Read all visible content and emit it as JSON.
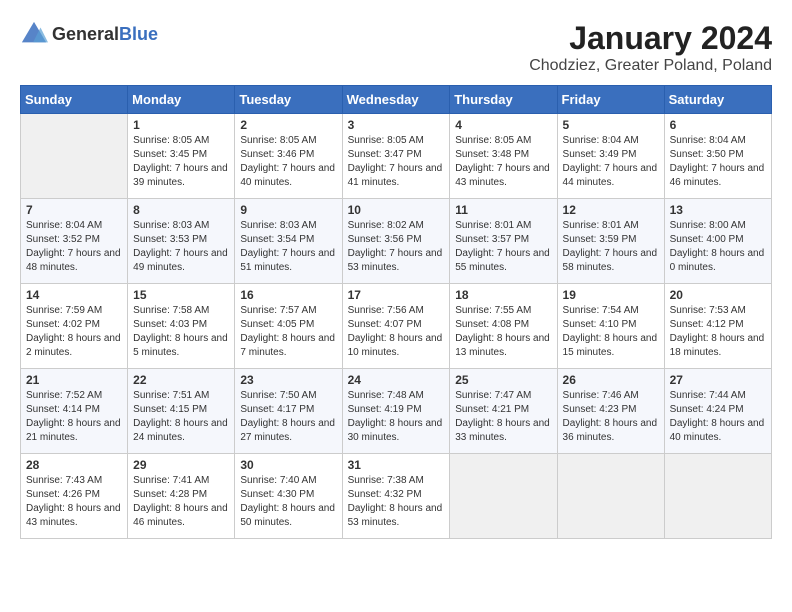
{
  "header": {
    "logo_general": "General",
    "logo_blue": "Blue",
    "title": "January 2024",
    "subtitle": "Chodziez, Greater Poland, Poland"
  },
  "weekdays": [
    "Sunday",
    "Monday",
    "Tuesday",
    "Wednesday",
    "Thursday",
    "Friday",
    "Saturday"
  ],
  "weeks": [
    [
      {
        "day": "",
        "sunrise": "",
        "sunset": "",
        "daylight": ""
      },
      {
        "day": "1",
        "sunrise": "Sunrise: 8:05 AM",
        "sunset": "Sunset: 3:45 PM",
        "daylight": "Daylight: 7 hours and 39 minutes."
      },
      {
        "day": "2",
        "sunrise": "Sunrise: 8:05 AM",
        "sunset": "Sunset: 3:46 PM",
        "daylight": "Daylight: 7 hours and 40 minutes."
      },
      {
        "day": "3",
        "sunrise": "Sunrise: 8:05 AM",
        "sunset": "Sunset: 3:47 PM",
        "daylight": "Daylight: 7 hours and 41 minutes."
      },
      {
        "day": "4",
        "sunrise": "Sunrise: 8:05 AM",
        "sunset": "Sunset: 3:48 PM",
        "daylight": "Daylight: 7 hours and 43 minutes."
      },
      {
        "day": "5",
        "sunrise": "Sunrise: 8:04 AM",
        "sunset": "Sunset: 3:49 PM",
        "daylight": "Daylight: 7 hours and 44 minutes."
      },
      {
        "day": "6",
        "sunrise": "Sunrise: 8:04 AM",
        "sunset": "Sunset: 3:50 PM",
        "daylight": "Daylight: 7 hours and 46 minutes."
      }
    ],
    [
      {
        "day": "7",
        "sunrise": "Sunrise: 8:04 AM",
        "sunset": "Sunset: 3:52 PM",
        "daylight": "Daylight: 7 hours and 48 minutes."
      },
      {
        "day": "8",
        "sunrise": "Sunrise: 8:03 AM",
        "sunset": "Sunset: 3:53 PM",
        "daylight": "Daylight: 7 hours and 49 minutes."
      },
      {
        "day": "9",
        "sunrise": "Sunrise: 8:03 AM",
        "sunset": "Sunset: 3:54 PM",
        "daylight": "Daylight: 7 hours and 51 minutes."
      },
      {
        "day": "10",
        "sunrise": "Sunrise: 8:02 AM",
        "sunset": "Sunset: 3:56 PM",
        "daylight": "Daylight: 7 hours and 53 minutes."
      },
      {
        "day": "11",
        "sunrise": "Sunrise: 8:01 AM",
        "sunset": "Sunset: 3:57 PM",
        "daylight": "Daylight: 7 hours and 55 minutes."
      },
      {
        "day": "12",
        "sunrise": "Sunrise: 8:01 AM",
        "sunset": "Sunset: 3:59 PM",
        "daylight": "Daylight: 7 hours and 58 minutes."
      },
      {
        "day": "13",
        "sunrise": "Sunrise: 8:00 AM",
        "sunset": "Sunset: 4:00 PM",
        "daylight": "Daylight: 8 hours and 0 minutes."
      }
    ],
    [
      {
        "day": "14",
        "sunrise": "Sunrise: 7:59 AM",
        "sunset": "Sunset: 4:02 PM",
        "daylight": "Daylight: 8 hours and 2 minutes."
      },
      {
        "day": "15",
        "sunrise": "Sunrise: 7:58 AM",
        "sunset": "Sunset: 4:03 PM",
        "daylight": "Daylight: 8 hours and 5 minutes."
      },
      {
        "day": "16",
        "sunrise": "Sunrise: 7:57 AM",
        "sunset": "Sunset: 4:05 PM",
        "daylight": "Daylight: 8 hours and 7 minutes."
      },
      {
        "day": "17",
        "sunrise": "Sunrise: 7:56 AM",
        "sunset": "Sunset: 4:07 PM",
        "daylight": "Daylight: 8 hours and 10 minutes."
      },
      {
        "day": "18",
        "sunrise": "Sunrise: 7:55 AM",
        "sunset": "Sunset: 4:08 PM",
        "daylight": "Daylight: 8 hours and 13 minutes."
      },
      {
        "day": "19",
        "sunrise": "Sunrise: 7:54 AM",
        "sunset": "Sunset: 4:10 PM",
        "daylight": "Daylight: 8 hours and 15 minutes."
      },
      {
        "day": "20",
        "sunrise": "Sunrise: 7:53 AM",
        "sunset": "Sunset: 4:12 PM",
        "daylight": "Daylight: 8 hours and 18 minutes."
      }
    ],
    [
      {
        "day": "21",
        "sunrise": "Sunrise: 7:52 AM",
        "sunset": "Sunset: 4:14 PM",
        "daylight": "Daylight: 8 hours and 21 minutes."
      },
      {
        "day": "22",
        "sunrise": "Sunrise: 7:51 AM",
        "sunset": "Sunset: 4:15 PM",
        "daylight": "Daylight: 8 hours and 24 minutes."
      },
      {
        "day": "23",
        "sunrise": "Sunrise: 7:50 AM",
        "sunset": "Sunset: 4:17 PM",
        "daylight": "Daylight: 8 hours and 27 minutes."
      },
      {
        "day": "24",
        "sunrise": "Sunrise: 7:48 AM",
        "sunset": "Sunset: 4:19 PM",
        "daylight": "Daylight: 8 hours and 30 minutes."
      },
      {
        "day": "25",
        "sunrise": "Sunrise: 7:47 AM",
        "sunset": "Sunset: 4:21 PM",
        "daylight": "Daylight: 8 hours and 33 minutes."
      },
      {
        "day": "26",
        "sunrise": "Sunrise: 7:46 AM",
        "sunset": "Sunset: 4:23 PM",
        "daylight": "Daylight: 8 hours and 36 minutes."
      },
      {
        "day": "27",
        "sunrise": "Sunrise: 7:44 AM",
        "sunset": "Sunset: 4:24 PM",
        "daylight": "Daylight: 8 hours and 40 minutes."
      }
    ],
    [
      {
        "day": "28",
        "sunrise": "Sunrise: 7:43 AM",
        "sunset": "Sunset: 4:26 PM",
        "daylight": "Daylight: 8 hours and 43 minutes."
      },
      {
        "day": "29",
        "sunrise": "Sunrise: 7:41 AM",
        "sunset": "Sunset: 4:28 PM",
        "daylight": "Daylight: 8 hours and 46 minutes."
      },
      {
        "day": "30",
        "sunrise": "Sunrise: 7:40 AM",
        "sunset": "Sunset: 4:30 PM",
        "daylight": "Daylight: 8 hours and 50 minutes."
      },
      {
        "day": "31",
        "sunrise": "Sunrise: 7:38 AM",
        "sunset": "Sunset: 4:32 PM",
        "daylight": "Daylight: 8 hours and 53 minutes."
      },
      {
        "day": "",
        "sunrise": "",
        "sunset": "",
        "daylight": ""
      },
      {
        "day": "",
        "sunrise": "",
        "sunset": "",
        "daylight": ""
      },
      {
        "day": "",
        "sunrise": "",
        "sunset": "",
        "daylight": ""
      }
    ]
  ]
}
